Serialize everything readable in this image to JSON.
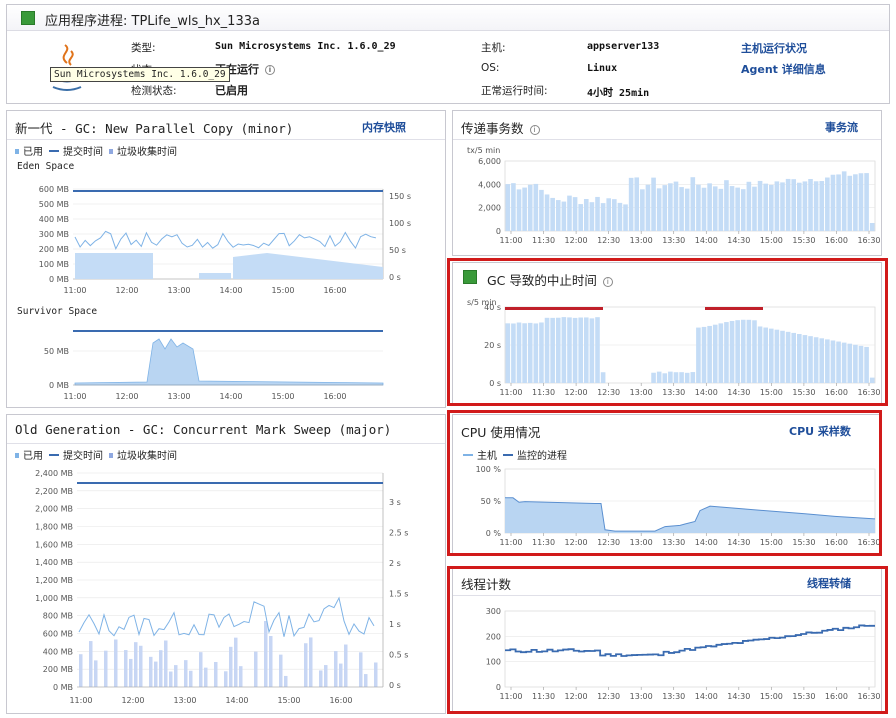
{
  "header": {
    "title": "应用程序进程: TPLife_wls_hx_133a",
    "type_label": "类型:",
    "type_value": "Sun Microsystems Inc. 1.6.0_29",
    "status_label": "状态:",
    "status_value": "正在运行",
    "detect_label": "检测状态:",
    "detect_value": "已启用",
    "host_label": "主机:",
    "host_value": "appserver133",
    "os_label": "OS:",
    "os_value": "Linux",
    "uptime_label": "正常运行时间:",
    "uptime_value": "4小时 25min",
    "link_host": "主机运行状况",
    "link_agent": "Agent 详细信息",
    "tooltip": "Sun Microsystems Inc. 1.6.0_29"
  },
  "legend": {
    "used": "已用",
    "committed": "提交时间",
    "gc_time": "垃圾收集时间"
  },
  "young_panel": {
    "title": "新一代 - GC: New Parallel Copy (minor)",
    "link": "内存快照",
    "eden_label": "Eden Space",
    "survivor_label": "Survivor Space",
    "x_ticks": [
      "11:00",
      "12:00",
      "13:00",
      "14:00",
      "15:00",
      "16:00"
    ],
    "eden_y_ticks": [
      "600 MB",
      "500 MB",
      "400 MB",
      "300 MB",
      "200 MB",
      "100 MB",
      "0 MB"
    ],
    "eden_y2_ticks": [
      "150 s",
      "100 s",
      "50 s",
      "0 s"
    ],
    "survivor_y_ticks": [
      "50 MB",
      "0 MB"
    ]
  },
  "old_panel": {
    "title": "Old Generation - GC: Concurrent Mark Sweep (major)",
    "x_ticks": [
      "11:00",
      "12:00",
      "13:00",
      "14:00",
      "15:00",
      "16:00"
    ],
    "y_ticks": [
      "2,400 MB",
      "2,200 MB",
      "2,000 MB",
      "1,800 MB",
      "1,600 MB",
      "1,400 MB",
      "1,200 MB",
      "1,000 MB",
      "800 MB",
      "600 MB",
      "400 MB",
      "200 MB",
      "0 MB"
    ],
    "y2_ticks": [
      "3 s",
      "2.5 s",
      "2 s",
      "1.5 s",
      "1 s",
      "0.5 s",
      "0 s"
    ]
  },
  "tx_panel": {
    "title": "传递事务数",
    "link": "事务流",
    "unit": "tx/5 min",
    "y_ticks": [
      "6,000",
      "4,000",
      "2,000",
      "0"
    ],
    "x_ticks": [
      "11:00",
      "11:30",
      "12:00",
      "12:30",
      "13:00",
      "13:30",
      "14:00",
      "14:30",
      "15:00",
      "15:30",
      "16:00",
      "16:30"
    ]
  },
  "gc_panel": {
    "title": "GC 导致的中止时间",
    "unit": "s/5 min",
    "y_ticks": [
      "40 s",
      "20 s",
      "0 s"
    ],
    "x_ticks": [
      "11:00",
      "11:30",
      "12:00",
      "12:30",
      "13:00",
      "13:30",
      "14:00",
      "14:30",
      "15:00",
      "15:30",
      "16:00",
      "16:30"
    ]
  },
  "cpu_panel": {
    "title": "CPU 使用情况",
    "link": "CPU 采样数",
    "legend_host": "主机",
    "legend_proc": "监控的进程",
    "y_ticks": [
      "100 %",
      "50 %",
      "0 %"
    ],
    "x_ticks": [
      "11:00",
      "11:30",
      "12:00",
      "12:30",
      "13:00",
      "13:30",
      "14:00",
      "14:30",
      "15:00",
      "15:30",
      "16:00",
      "16:30"
    ]
  },
  "thread_panel": {
    "title": "线程计数",
    "link": "线程转储",
    "y_ticks": [
      "300",
      "200",
      "100",
      "0"
    ],
    "x_ticks": [
      "11:00",
      "11:30",
      "12:00",
      "12:30",
      "13:00",
      "13:30",
      "14:00",
      "14:30",
      "15:00",
      "15:30",
      "16:00",
      "16:30"
    ]
  },
  "colors": {
    "bar": "#c4dcf6",
    "bar_edge": "#a9c9ee",
    "line": "#3a6bb0",
    "area": "#b9d5f2",
    "gc_red": "#c0202a",
    "highlight": "#d11a1a",
    "status_green": "#3a9a3a"
  }
}
